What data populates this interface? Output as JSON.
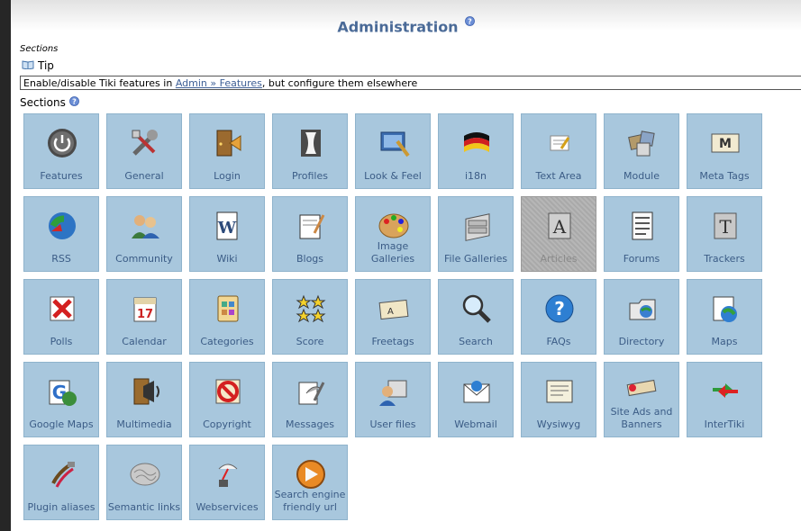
{
  "header": {
    "title": "Administration"
  },
  "sections_small_label": "Sections",
  "tip": {
    "label": "Tip",
    "text_before": "Enable/disable Tiki features in ",
    "link_text": "Admin » Features",
    "text_after": ", but configure them elsewhere"
  },
  "sections_label": "Sections",
  "tiles": [
    {
      "label": "Features",
      "icon": "power-icon"
    },
    {
      "label": "General",
      "icon": "tools-icon"
    },
    {
      "label": "Login",
      "icon": "login-door-icon"
    },
    {
      "label": "Profiles",
      "icon": "profiles-icon"
    },
    {
      "label": "Look & Feel",
      "icon": "look-feel-icon"
    },
    {
      "label": "i18n",
      "icon": "flag-icon"
    },
    {
      "label": "Text Area",
      "icon": "text-area-icon"
    },
    {
      "label": "Module",
      "icon": "module-icon"
    },
    {
      "label": "Meta Tags",
      "icon": "meta-tags-icon"
    },
    {
      "label": "RSS",
      "icon": "rss-icon"
    },
    {
      "label": "Community",
      "icon": "community-icon"
    },
    {
      "label": "Wiki",
      "icon": "wiki-icon"
    },
    {
      "label": "Blogs",
      "icon": "blogs-icon"
    },
    {
      "label": "Image Galleries",
      "icon": "palette-icon"
    },
    {
      "label": "File Galleries",
      "icon": "file-cabinet-icon"
    },
    {
      "label": "Articles",
      "icon": "articles-icon",
      "disabled": true
    },
    {
      "label": "Forums",
      "icon": "forums-icon"
    },
    {
      "label": "Trackers",
      "icon": "trackers-icon"
    },
    {
      "label": "Polls",
      "icon": "polls-icon"
    },
    {
      "label": "Calendar",
      "icon": "calendar-icon"
    },
    {
      "label": "Categories",
      "icon": "categories-icon"
    },
    {
      "label": "Score",
      "icon": "stars-icon"
    },
    {
      "label": "Freetags",
      "icon": "freetags-icon"
    },
    {
      "label": "Search",
      "icon": "magnifier-icon"
    },
    {
      "label": "FAQs",
      "icon": "question-icon"
    },
    {
      "label": "Directory",
      "icon": "directory-icon"
    },
    {
      "label": "Maps",
      "icon": "maps-icon"
    },
    {
      "label": "Google Maps",
      "icon": "google-maps-icon"
    },
    {
      "label": "Multimedia",
      "icon": "multimedia-icon"
    },
    {
      "label": "Copyright",
      "icon": "copyright-icon"
    },
    {
      "label": "Messages",
      "icon": "messages-icon"
    },
    {
      "label": "User files",
      "icon": "user-files-icon"
    },
    {
      "label": "Webmail",
      "icon": "webmail-icon"
    },
    {
      "label": "Wysiwyg",
      "icon": "wysiwyg-icon"
    },
    {
      "label": "Site Ads and Banners",
      "icon": "banners-icon"
    },
    {
      "label": "InterTiki",
      "icon": "intertiki-icon"
    },
    {
      "label": "Plugin aliases",
      "icon": "plugin-icon"
    },
    {
      "label": "Semantic links",
      "icon": "brain-icon"
    },
    {
      "label": "Webservices",
      "icon": "webservices-icon"
    },
    {
      "label": "Search engine friendly url",
      "icon": "sefurl-icon"
    }
  ],
  "colors": {
    "tile_bg": "#a8c7dd",
    "tile_label": "#3b5c86",
    "title": "#4a6a97",
    "link": "#3d5f96"
  }
}
